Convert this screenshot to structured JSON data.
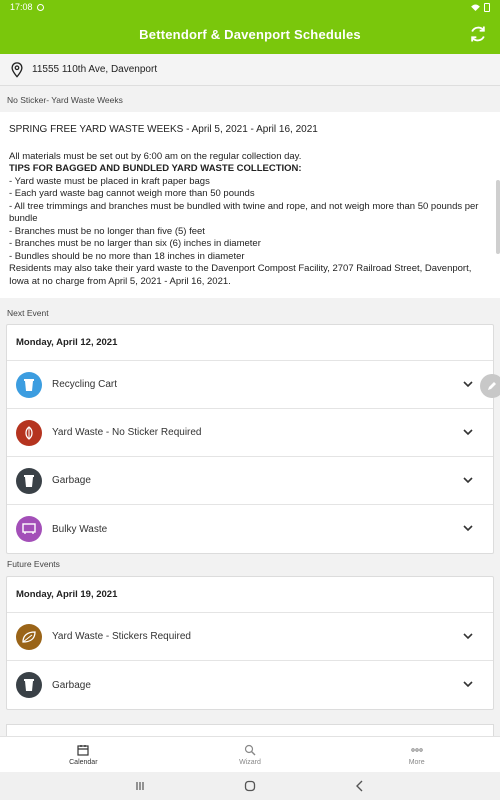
{
  "status": {
    "time": "17:08"
  },
  "app": {
    "title": "Bettendorf & Davenport Schedules"
  },
  "address": {
    "text": "11555 110th Ave, Davenport"
  },
  "notice_section": {
    "label": "No Sticker- Yard Waste Weeks"
  },
  "notice": {
    "headline": "SPRING FREE YARD WASTE WEEKS - April 5, 2021 - April 16, 2021",
    "intro": "All materials must be set out by 6:00 am on the regular collection day.",
    "tips_title": "TIPS FOR BAGGED AND BUNDLED YARD WASTE COLLECTION:",
    "tips": [
      "- Yard waste must be placed in kraft paper bags",
      "- Each yard waste bag cannot weigh more than 50 pounds",
      "- All tree trimmings and branches must be bundled with twine and rope, and not weigh more than 50 pounds per bundle",
      "- Branches must be no longer than five (5) feet",
      "- Branches must be no larger than six (6) inches in diameter",
      "- Bundles should be no more than 18 inches in diameter"
    ],
    "footer": "Residents may also take their yard waste to the Davenport Compost Facility, 2707 Railroad Street, Davenport, Iowa at no charge from April 5, 2021 - April 16, 2021."
  },
  "next_event": {
    "label": "Next Event",
    "date": "Monday, April 12, 2021",
    "items": [
      {
        "label": "Recycling Cart",
        "color": "#3c9de0",
        "icon": "recycling-cart-icon"
      },
      {
        "label": "Yard Waste - No Sticker Required",
        "color": "#b5341f",
        "icon": "leaf-icon"
      },
      {
        "label": "Garbage",
        "color": "#3a4147",
        "icon": "garbage-cart-icon"
      },
      {
        "label": "Bulky Waste",
        "color": "#a34fb8",
        "icon": "bulky-waste-icon"
      }
    ]
  },
  "future_events": {
    "label": "Future Events",
    "date": "Monday, April 19, 2021",
    "items": [
      {
        "label": "Yard Waste - Stickers Required",
        "color": "#9a6418",
        "icon": "leaf-icon"
      },
      {
        "label": "Garbage",
        "color": "#3a4147",
        "icon": "garbage-cart-icon"
      }
    ]
  },
  "bottom_nav": {
    "calendar": "Calendar",
    "wizard": "Wizard",
    "more": "More"
  },
  "colors": {
    "brand": "#7ac70c"
  }
}
